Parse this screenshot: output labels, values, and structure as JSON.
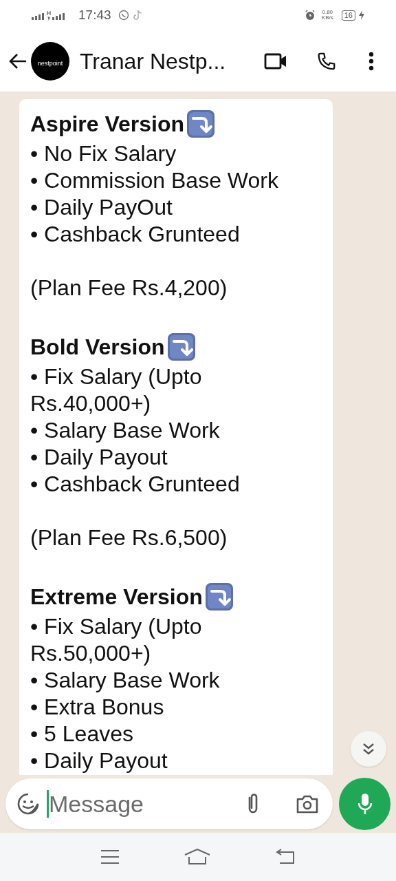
{
  "status_bar": {
    "time": "17:43",
    "net_speed": "0.80",
    "net_unit": "KB/s",
    "battery": "16"
  },
  "header": {
    "avatar_text": "nestpoint",
    "title": "Tranar Nestp..."
  },
  "message": {
    "sections": [
      {
        "heading": "Aspire Version",
        "items": [
          "• No Fix Salary",
          "• Commission Base Work",
          "• Daily PayOut",
          "• Cashback Grunteed"
        ],
        "fee": "(Plan Fee Rs.4,200)"
      },
      {
        "heading": "Bold Version",
        "items": [
          "• Fix Salary (Upto Rs.40,000+)",
          "• Salary Base Work",
          "• Daily Payout",
          "• Cashback Grunteed"
        ],
        "fee": "(Plan Fee Rs.6,500)"
      },
      {
        "heading": "Extreme Version",
        "items": [
          "• Fix Salary (Upto Rs.50,000+)",
          "• Salary Base Work",
          "• Extra Bonus",
          "• 5 Leaves",
          "• Daily Payout"
        ]
      }
    ]
  },
  "composer": {
    "placeholder": "Message"
  }
}
